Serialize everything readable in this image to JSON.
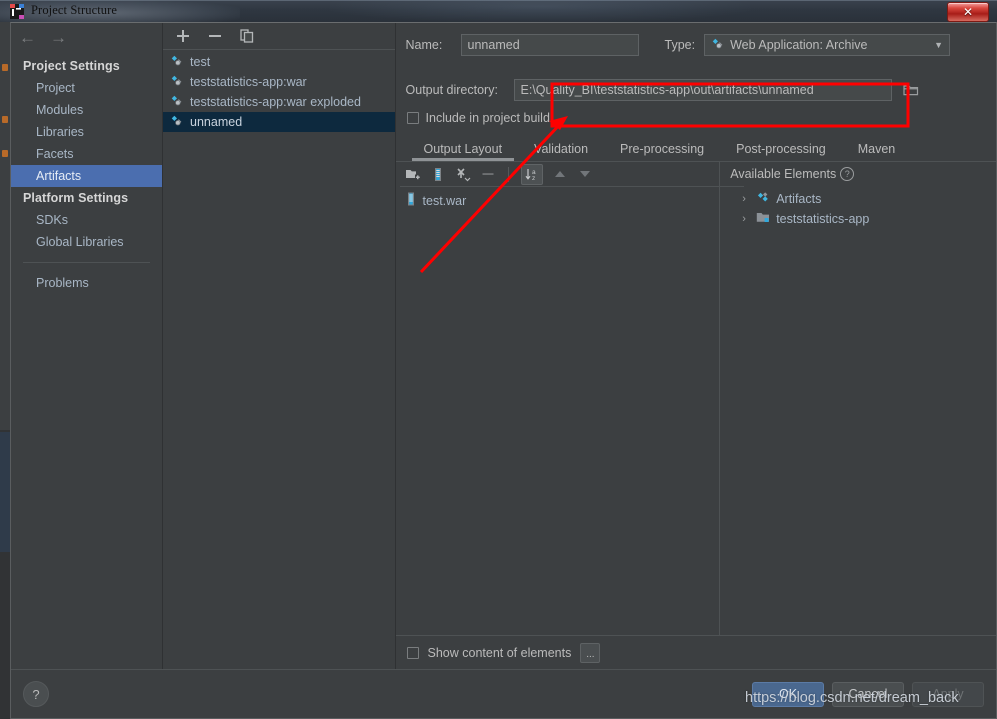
{
  "window": {
    "title": "Project Structure",
    "app_icon": "intellij-idea-icon",
    "close_label": "✕"
  },
  "nav": {
    "back_icon": "arrow-left-icon",
    "forward_icon": "arrow-right-icon"
  },
  "sidebar": {
    "groups": [
      {
        "title": "Project Settings",
        "items": [
          {
            "label": "Project",
            "selected": false
          },
          {
            "label": "Modules",
            "selected": false
          },
          {
            "label": "Libraries",
            "selected": false
          },
          {
            "label": "Facets",
            "selected": false
          },
          {
            "label": "Artifacts",
            "selected": true
          }
        ]
      },
      {
        "title": "Platform Settings",
        "items": [
          {
            "label": "SDKs",
            "selected": false
          },
          {
            "label": "Global Libraries",
            "selected": false
          }
        ]
      }
    ],
    "problems": {
      "label": "Problems"
    }
  },
  "artifacts_panel": {
    "toolbar": [
      {
        "icon": "plus-icon",
        "glyph": "+"
      },
      {
        "icon": "minus-icon",
        "glyph": "−"
      },
      {
        "icon": "copy-icon",
        "glyph": "❐"
      }
    ],
    "items": [
      {
        "label": "test",
        "selected": false
      },
      {
        "label": "teststatistics-app:war",
        "selected": false
      },
      {
        "label": "teststatistics-app:war exploded",
        "selected": false
      },
      {
        "label": "unnamed",
        "selected": true
      }
    ]
  },
  "detail": {
    "name_label": "Name:",
    "name_value": "unnamed",
    "name_placeholder": "",
    "type_label": "Type:",
    "type_value": "Web Application: Archive",
    "type_icon": "artifact-icon",
    "type_caret": "▼",
    "output_dir_label": "Output directory:",
    "output_dir_value": "E:\\Quality_BI\\teststatistics-app\\out\\artifacts\\unnamed",
    "output_dir_placeholder": "",
    "browse_icon": "folder-icon",
    "include_checkbox": {
      "label": "Include in project build",
      "checked": false
    },
    "tabs": [
      {
        "label": "Output Layout",
        "active": true
      },
      {
        "label": "Validation",
        "active": false
      },
      {
        "label": "Pre-processing",
        "active": false
      },
      {
        "label": "Post-processing",
        "active": false
      },
      {
        "label": "Maven",
        "active": false
      }
    ],
    "layout_toolbar": [
      {
        "icon": "add-directory-icon"
      },
      {
        "icon": "add-archive-icon"
      },
      {
        "icon": "add-copy-icon"
      },
      {
        "icon": "remove-icon",
        "glyph": "−"
      },
      {
        "icon": "sort-alphabetically-icon"
      },
      {
        "icon": "move-up-icon",
        "glyph": "▲"
      },
      {
        "icon": "move-down-icon",
        "glyph": "▼"
      }
    ],
    "layout_tree": [
      {
        "label": "test.war",
        "icon": "archive-icon"
      }
    ],
    "available_elements": {
      "title": "Available Elements",
      "help_glyph": "?",
      "items": [
        {
          "label": "Artifacts",
          "icon": "artifact-icon",
          "chevron": "›"
        },
        {
          "label": "teststatistics-app",
          "icon": "module-icon",
          "chevron": "›"
        }
      ]
    },
    "show_content": {
      "label": "Show content of elements",
      "checked": false
    },
    "dots_button": "..."
  },
  "footer": {
    "help_glyph": "?",
    "buttons": [
      {
        "label": "OK",
        "style": "primary"
      },
      {
        "label": "Cancel",
        "style": "normal"
      },
      {
        "label": "Apply",
        "style": "disabled"
      }
    ]
  },
  "annotations": {
    "watermark": "https://blog.csdn.net/dream_back",
    "highlight_color": "#ff0000",
    "arrow_color": "#ff0000"
  }
}
